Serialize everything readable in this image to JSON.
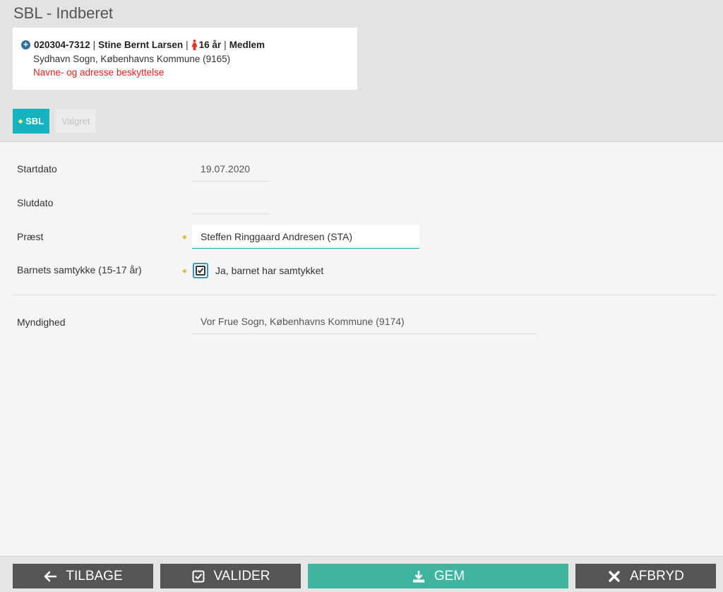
{
  "page": {
    "title": "SBL - Indberet"
  },
  "person": {
    "cpr": "020304-7312",
    "name": "Stine Bernt Larsen",
    "age": "16 år",
    "status": "Medlem",
    "address": "Sydhavn Sogn, Københavns Kommune (9165)",
    "protection": "Navne- og adresse beskyttelse"
  },
  "tabs": [
    {
      "label": "SBL",
      "active": true
    },
    {
      "label": "Valgret",
      "active": false
    }
  ],
  "form": {
    "startdato": {
      "label": "Startdato",
      "value": "19.07.2020"
    },
    "slutdato": {
      "label": "Slutdato",
      "value": ""
    },
    "praest": {
      "label": "Præst",
      "value": "Steffen Ringgaard Andresen (STA)"
    },
    "samtykke": {
      "label": "Barnets samtykke (15-17 år)",
      "checkbox_label": "Ja, barnet har samtykket",
      "checked": true
    },
    "myndighed": {
      "label": "Myndighed",
      "value": "Vor Frue Sogn, Københavns Kommune (9174)"
    }
  },
  "footer": {
    "back_label": "TILBAGE",
    "validate_label": "VALIDER",
    "save_label": "GEM",
    "cancel_label": "AFBRYD"
  },
  "colors": {
    "accent": "#15b3c0",
    "save": "#3fb5a0",
    "button_gray": "#555555",
    "warning": "#e02020"
  }
}
